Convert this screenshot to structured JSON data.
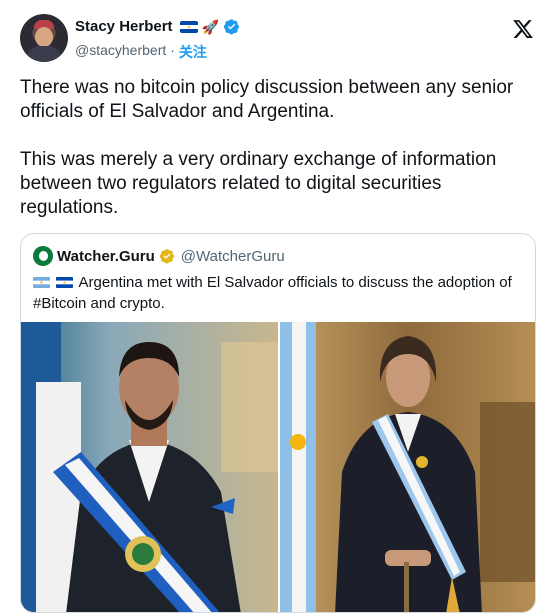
{
  "author": {
    "display_name": "Stacy Herbert",
    "handle": "@stacyherbert",
    "separator": "·",
    "follow_label": "关注",
    "flag_icon": "el-salvador-flag-icon",
    "emoji_icon": "rocket-icon",
    "verified_icon": "blue-verified-icon"
  },
  "platform_logo": "x-logo-icon",
  "tweet": {
    "paragraphs": [
      "There was no bitcoin policy discussion between any senior officials of El Salvador and Argentina.",
      "This was merely a very ordinary exchange of information between two regulators related to digital securities regulations."
    ]
  },
  "quoted_tweet": {
    "display_name": "Watcher.Guru",
    "handle": "@WatcherGuru",
    "verified_icon": "gold-verified-icon",
    "flags": [
      "argentina-flag-icon",
      "el-salvador-flag-icon"
    ],
    "text": "Argentina met with El Salvador officials to discuss the adoption of #Bitcoin and crypto.",
    "photos": [
      "photo-el-salvador-president",
      "photo-argentina-president"
    ]
  },
  "colors": {
    "accent": "#1d9bf0",
    "muted": "#536471",
    "border": "#cfd9de",
    "gold": "#e2b719"
  }
}
